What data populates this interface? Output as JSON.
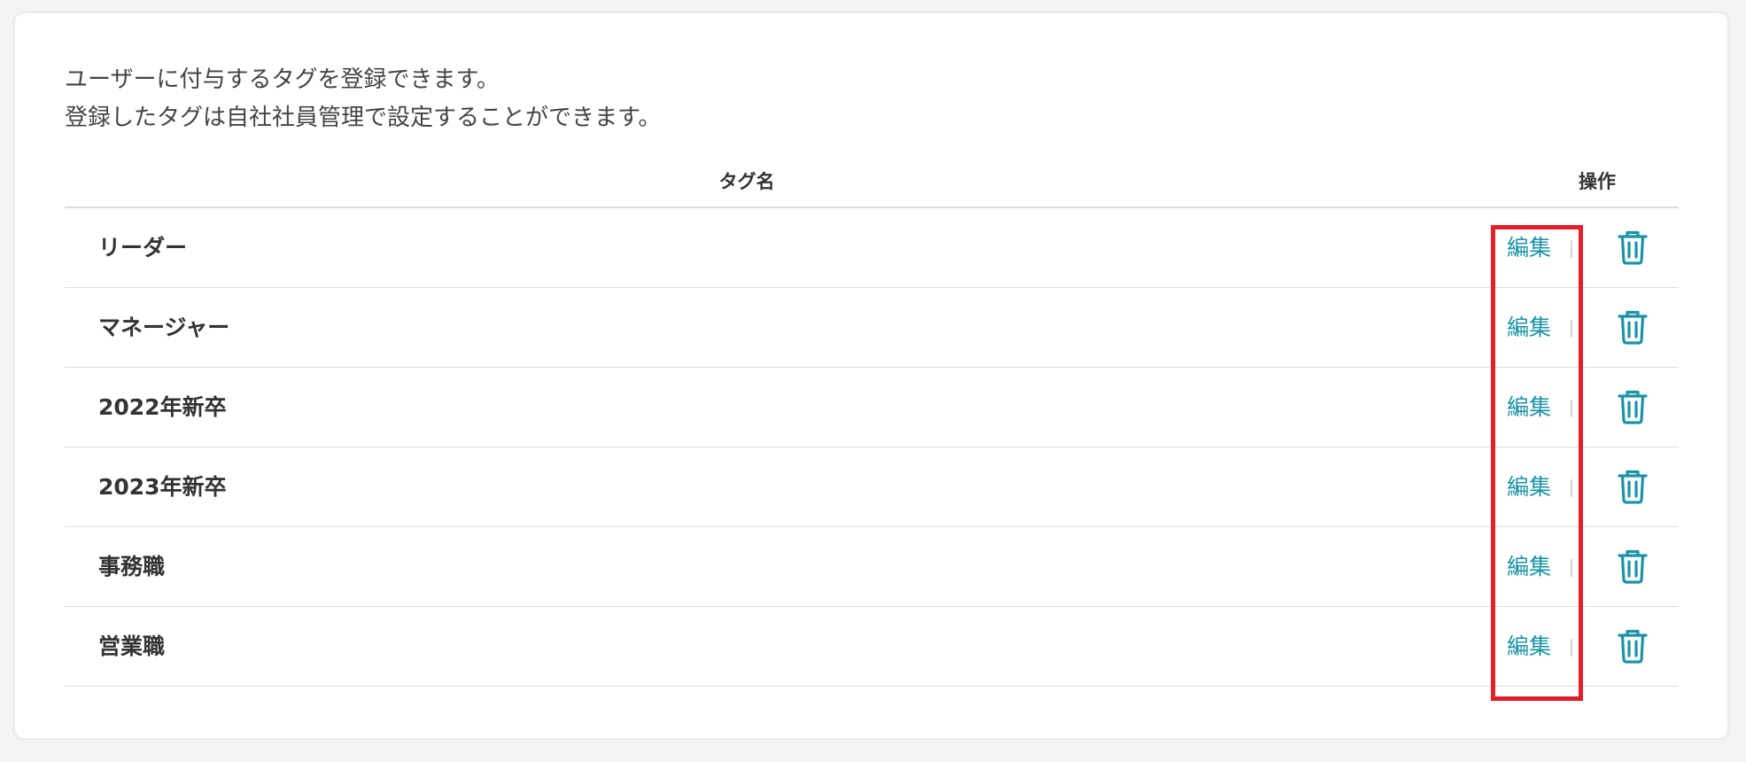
{
  "description": {
    "line1": "ユーザーに付与するタグを登録できます。",
    "line2": "登録したタグは自社社員管理で設定することができます。"
  },
  "table": {
    "headers": {
      "name": "タグ名",
      "actions": "操作"
    },
    "edit_label": "編集",
    "rows": [
      {
        "name": "リーダー"
      },
      {
        "name": "マネージャー"
      },
      {
        "name": "2022年新卒"
      },
      {
        "name": "2023年新卒"
      },
      {
        "name": "事務職"
      },
      {
        "name": "営業職"
      }
    ]
  },
  "icons": {
    "delete": "trash-icon"
  },
  "colors": {
    "accent": "#1a93a6",
    "highlight": "#e3202a",
    "text": "#333333"
  }
}
